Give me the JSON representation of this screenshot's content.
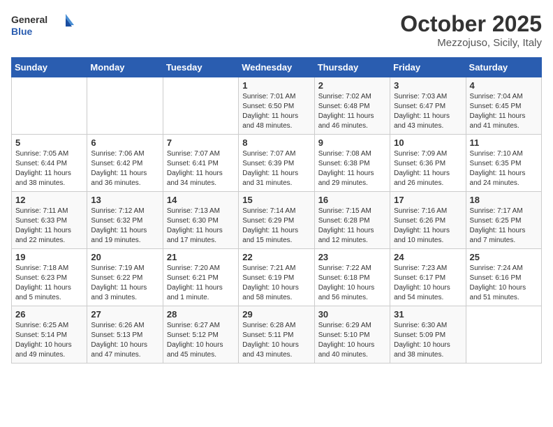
{
  "logo": {
    "line1": "General",
    "line2": "Blue"
  },
  "title": "October 2025",
  "subtitle": "Mezzojuso, Sicily, Italy",
  "weekdays": [
    "Sunday",
    "Monday",
    "Tuesday",
    "Wednesday",
    "Thursday",
    "Friday",
    "Saturday"
  ],
  "weeks": [
    [
      {
        "day": "",
        "info": ""
      },
      {
        "day": "",
        "info": ""
      },
      {
        "day": "",
        "info": ""
      },
      {
        "day": "1",
        "info": "Sunrise: 7:01 AM\nSunset: 6:50 PM\nDaylight: 11 hours\nand 48 minutes."
      },
      {
        "day": "2",
        "info": "Sunrise: 7:02 AM\nSunset: 6:48 PM\nDaylight: 11 hours\nand 46 minutes."
      },
      {
        "day": "3",
        "info": "Sunrise: 7:03 AM\nSunset: 6:47 PM\nDaylight: 11 hours\nand 43 minutes."
      },
      {
        "day": "4",
        "info": "Sunrise: 7:04 AM\nSunset: 6:45 PM\nDaylight: 11 hours\nand 41 minutes."
      }
    ],
    [
      {
        "day": "5",
        "info": "Sunrise: 7:05 AM\nSunset: 6:44 PM\nDaylight: 11 hours\nand 38 minutes."
      },
      {
        "day": "6",
        "info": "Sunrise: 7:06 AM\nSunset: 6:42 PM\nDaylight: 11 hours\nand 36 minutes."
      },
      {
        "day": "7",
        "info": "Sunrise: 7:07 AM\nSunset: 6:41 PM\nDaylight: 11 hours\nand 34 minutes."
      },
      {
        "day": "8",
        "info": "Sunrise: 7:07 AM\nSunset: 6:39 PM\nDaylight: 11 hours\nand 31 minutes."
      },
      {
        "day": "9",
        "info": "Sunrise: 7:08 AM\nSunset: 6:38 PM\nDaylight: 11 hours\nand 29 minutes."
      },
      {
        "day": "10",
        "info": "Sunrise: 7:09 AM\nSunset: 6:36 PM\nDaylight: 11 hours\nand 26 minutes."
      },
      {
        "day": "11",
        "info": "Sunrise: 7:10 AM\nSunset: 6:35 PM\nDaylight: 11 hours\nand 24 minutes."
      }
    ],
    [
      {
        "day": "12",
        "info": "Sunrise: 7:11 AM\nSunset: 6:33 PM\nDaylight: 11 hours\nand 22 minutes."
      },
      {
        "day": "13",
        "info": "Sunrise: 7:12 AM\nSunset: 6:32 PM\nDaylight: 11 hours\nand 19 minutes."
      },
      {
        "day": "14",
        "info": "Sunrise: 7:13 AM\nSunset: 6:30 PM\nDaylight: 11 hours\nand 17 minutes."
      },
      {
        "day": "15",
        "info": "Sunrise: 7:14 AM\nSunset: 6:29 PM\nDaylight: 11 hours\nand 15 minutes."
      },
      {
        "day": "16",
        "info": "Sunrise: 7:15 AM\nSunset: 6:28 PM\nDaylight: 11 hours\nand 12 minutes."
      },
      {
        "day": "17",
        "info": "Sunrise: 7:16 AM\nSunset: 6:26 PM\nDaylight: 11 hours\nand 10 minutes."
      },
      {
        "day": "18",
        "info": "Sunrise: 7:17 AM\nSunset: 6:25 PM\nDaylight: 11 hours\nand 7 minutes."
      }
    ],
    [
      {
        "day": "19",
        "info": "Sunrise: 7:18 AM\nSunset: 6:23 PM\nDaylight: 11 hours\nand 5 minutes."
      },
      {
        "day": "20",
        "info": "Sunrise: 7:19 AM\nSunset: 6:22 PM\nDaylight: 11 hours\nand 3 minutes."
      },
      {
        "day": "21",
        "info": "Sunrise: 7:20 AM\nSunset: 6:21 PM\nDaylight: 11 hours\nand 1 minute."
      },
      {
        "day": "22",
        "info": "Sunrise: 7:21 AM\nSunset: 6:19 PM\nDaylight: 10 hours\nand 58 minutes."
      },
      {
        "day": "23",
        "info": "Sunrise: 7:22 AM\nSunset: 6:18 PM\nDaylight: 10 hours\nand 56 minutes."
      },
      {
        "day": "24",
        "info": "Sunrise: 7:23 AM\nSunset: 6:17 PM\nDaylight: 10 hours\nand 54 minutes."
      },
      {
        "day": "25",
        "info": "Sunrise: 7:24 AM\nSunset: 6:16 PM\nDaylight: 10 hours\nand 51 minutes."
      }
    ],
    [
      {
        "day": "26",
        "info": "Sunrise: 6:25 AM\nSunset: 5:14 PM\nDaylight: 10 hours\nand 49 minutes."
      },
      {
        "day": "27",
        "info": "Sunrise: 6:26 AM\nSunset: 5:13 PM\nDaylight: 10 hours\nand 47 minutes."
      },
      {
        "day": "28",
        "info": "Sunrise: 6:27 AM\nSunset: 5:12 PM\nDaylight: 10 hours\nand 45 minutes."
      },
      {
        "day": "29",
        "info": "Sunrise: 6:28 AM\nSunset: 5:11 PM\nDaylight: 10 hours\nand 43 minutes."
      },
      {
        "day": "30",
        "info": "Sunrise: 6:29 AM\nSunset: 5:10 PM\nDaylight: 10 hours\nand 40 minutes."
      },
      {
        "day": "31",
        "info": "Sunrise: 6:30 AM\nSunset: 5:09 PM\nDaylight: 10 hours\nand 38 minutes."
      },
      {
        "day": "",
        "info": ""
      }
    ]
  ]
}
